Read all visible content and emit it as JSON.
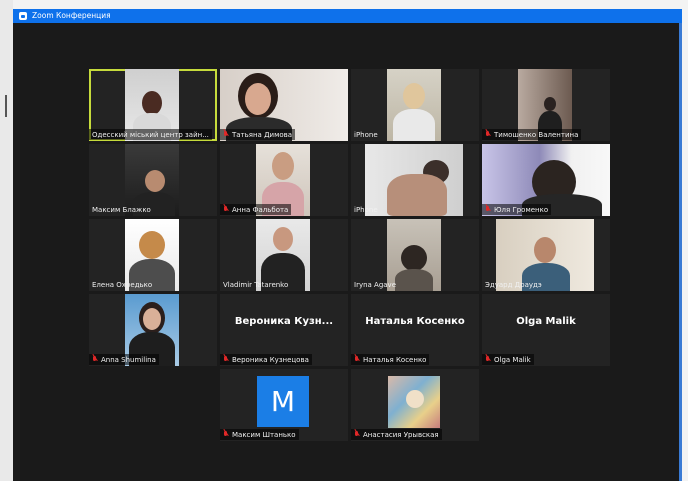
{
  "window": {
    "title": "Zoom Конференция"
  },
  "tiles": [
    {
      "name": "Одесский міський центр зайн...",
      "muted": false,
      "active": true
    },
    {
      "name": "Татьяна Димова",
      "muted": true
    },
    {
      "name": "iPhone",
      "muted": false
    },
    {
      "name": "Тимошенко Валентина",
      "muted": true
    },
    {
      "name": "Максим Блажко",
      "muted": false
    },
    {
      "name": "Анна Фальбота",
      "muted": true
    },
    {
      "name": "iPhone",
      "muted": false
    },
    {
      "name": "Юля Громенко",
      "muted": true
    },
    {
      "name": "Елена Охредько",
      "muted": false
    },
    {
      "name": "Vladimir Tatarenko",
      "muted": false
    },
    {
      "name": "Iryna Agave",
      "muted": false
    },
    {
      "name": "Эдуард Драудэ",
      "muted": false
    },
    {
      "name": "Anna Shumilina",
      "muted": true
    },
    {
      "name": "Вероника Кузнецова",
      "muted": true,
      "display": "Вероника Кузн..."
    },
    {
      "name": "Наталья Косенко",
      "muted": true,
      "display": "Наталья Косенко"
    },
    {
      "name": "Olga Malik",
      "muted": true,
      "display": "Olga Malik"
    },
    {
      "name": "Максим Штанько",
      "muted": true,
      "initial": "M"
    },
    {
      "name": "Анастасия Урывская",
      "muted": true
    }
  ],
  "colors": {
    "titlebar": "#0e71eb",
    "active_border": "#c6db3c",
    "mute_icon": "#e02828",
    "avatar": "#1b7ee6"
  }
}
